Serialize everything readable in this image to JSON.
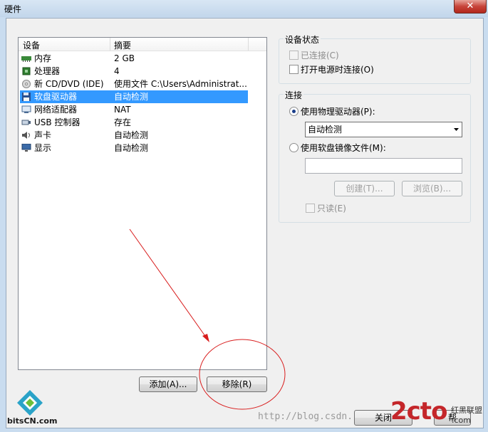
{
  "window": {
    "title": "硬件",
    "close_glyph": "✕"
  },
  "devices": {
    "header": {
      "device": "设备",
      "summary": "摘要"
    },
    "rows": [
      {
        "name": "内存",
        "summary": "2 GB",
        "icon": "memory-icon"
      },
      {
        "name": "处理器",
        "summary": "4",
        "icon": "processor-icon"
      },
      {
        "name": "新 CD/DVD (IDE)",
        "summary": "使用文件 C:\\Users\\Administrat...",
        "icon": "cd-dvd-icon"
      },
      {
        "name": "软盘驱动器",
        "summary": "自动检测",
        "icon": "floppy-icon",
        "selected": true
      },
      {
        "name": "网络适配器",
        "summary": "NAT",
        "icon": "network-icon"
      },
      {
        "name": "USB 控制器",
        "summary": "存在",
        "icon": "usb-icon"
      },
      {
        "name": "声卡",
        "summary": "自动检测",
        "icon": "sound-icon"
      },
      {
        "name": "显示",
        "summary": "自动检测",
        "icon": "display-icon"
      }
    ],
    "add_label": "添加(A)...",
    "remove_label": "移除(R)"
  },
  "status": {
    "title": "设备状态",
    "connected": "已连接(C)",
    "connect_on_power": "打开电源时连接(O)"
  },
  "connection": {
    "title": "连接",
    "use_physical": "使用物理驱动器(P):",
    "drive_value": "自动检测",
    "use_image": "使用软盘镜像文件(M):",
    "create": "创建(T)...",
    "browse": "浏览(B)...",
    "readonly": "只读(E)"
  },
  "footer": {
    "close_label": "关闭",
    "help_label": "帮"
  },
  "watermarks": {
    "url": "http://blog.csdn.",
    "bits": "bitsCN.com",
    "cto": "2cto",
    "cto_suffix": ".com",
    "hongheilianmeng": "红黑联盟"
  },
  "colors": {
    "selection": "#3399ff",
    "annotation": "#d81b1b"
  }
}
